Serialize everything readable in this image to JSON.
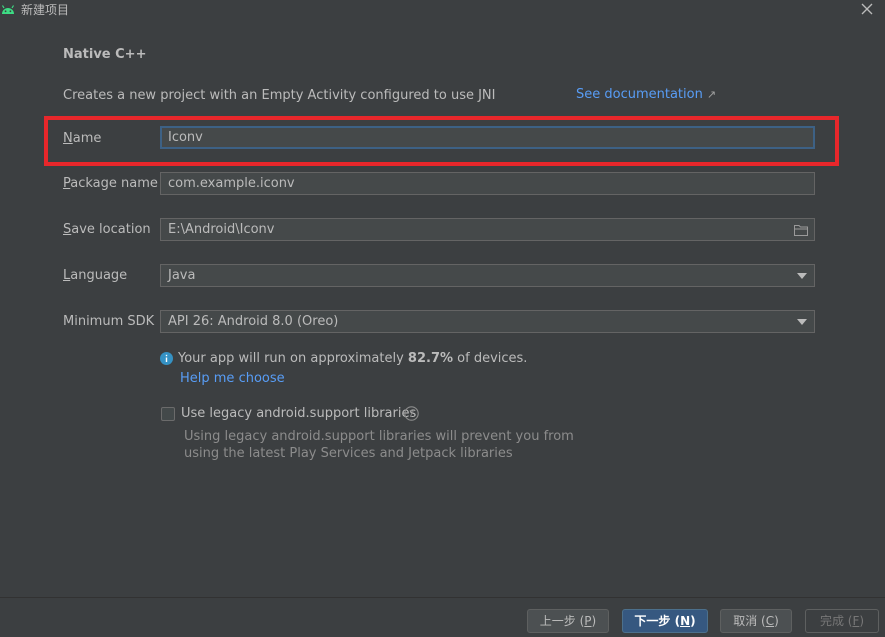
{
  "window": {
    "title": "新建项目"
  },
  "header": {
    "heading": "Native C++",
    "description": "Creates a new project with an Empty Activity configured to use JNI",
    "doc_link": "See documentation",
    "doc_link_arrow": "↗"
  },
  "form": {
    "name": {
      "label_mnemonic": "N",
      "label_rest": "ame",
      "value": "Iconv"
    },
    "package": {
      "label_mnemonic": "P",
      "label_rest": "ackage name",
      "value": "com.example.iconv"
    },
    "save_location": {
      "label_mnemonic": "S",
      "label_rest": "ave location",
      "value": "E:\\Android\\Iconv"
    },
    "language": {
      "label_mnemonic": "L",
      "label_rest": "anguage",
      "value": "Java"
    },
    "min_sdk": {
      "label": "Minimum SDK",
      "value": "API 26: Android 8.0 (Oreo)"
    }
  },
  "info": {
    "prefix": "Your app will run on approximately ",
    "percent": "82.7%",
    "suffix": " of devices.",
    "help_link": "Help me choose"
  },
  "legacy": {
    "label": "Use legacy android.support libraries",
    "checked": false,
    "note": "Using legacy android.support libraries will prevent you from using the latest Play Services and Jetpack libraries"
  },
  "buttons": {
    "previous": {
      "label": "上一步 (",
      "mnemonic": "P",
      "end": ")"
    },
    "next": {
      "label": "下一步 (",
      "mnemonic": "N",
      "end": ")"
    },
    "cancel": {
      "label": "取消 (",
      "mnemonic": "C",
      "end": ")"
    },
    "finish": {
      "label": "完成 (",
      "mnemonic": "F",
      "end": ")"
    }
  },
  "colors": {
    "background": "#3c3f41",
    "link": "#589df6",
    "highlight": "#e8272b",
    "primary_button": "#365880",
    "android_green": "#3ddc84"
  },
  "icons": [
    "android-icon",
    "close-icon",
    "folder-icon",
    "dropdown-arrow-icon",
    "info-icon",
    "question-icon",
    "external-link-icon"
  ]
}
